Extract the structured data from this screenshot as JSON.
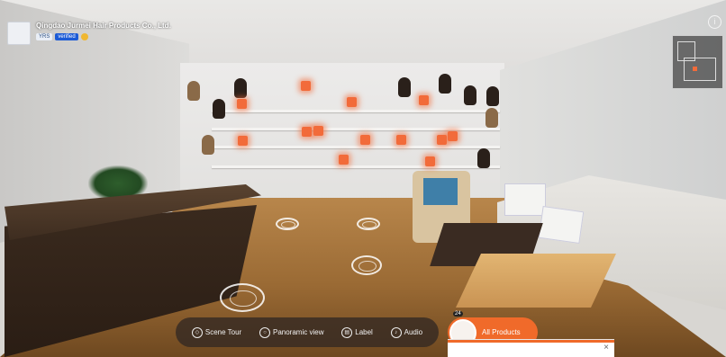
{
  "company": {
    "name": "Qingdao Jurmei Hair Products Co., Ltd.",
    "years_badge": "YRS",
    "verified_badge": "verified",
    "medal_icon": "medal-icon"
  },
  "header": {
    "info_icon": "info-icon",
    "minimap_icon": "minimap-icon"
  },
  "toolbar": {
    "items": [
      {
        "label": "Scene Tour",
        "icon": "cube-icon"
      },
      {
        "label": "Panoramic view",
        "icon": "panorama-icon"
      },
      {
        "label": "Label",
        "icon": "label-icon"
      },
      {
        "label": "Audio",
        "icon": "audio-icon"
      }
    ]
  },
  "products": {
    "label": "All Products",
    "count": "24"
  },
  "popup": {
    "close_label": "×"
  },
  "colors": {
    "accent": "#f06a2a",
    "hotspot": "#f26b3a",
    "verified": "#1c5bd6"
  }
}
